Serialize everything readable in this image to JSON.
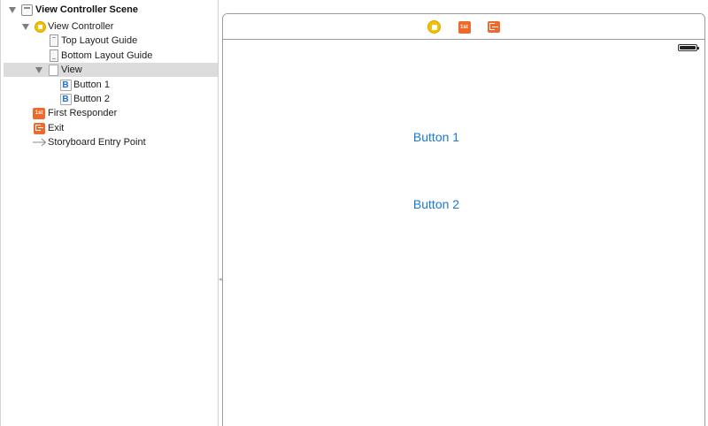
{
  "outline": {
    "items": [
      {
        "label": "View Controller Scene",
        "icon": "scene-icon",
        "disclosure": "expanded"
      },
      {
        "label": "View Controller",
        "icon": "view-controller-icon",
        "disclosure": "expanded"
      },
      {
        "label": "Top Layout Guide",
        "icon": "layout-guide-icon"
      },
      {
        "label": "Bottom Layout Guide",
        "icon": "layout-guide-icon"
      },
      {
        "label": "View",
        "icon": "view-icon",
        "disclosure": "expanded",
        "selected": true
      },
      {
        "label": "Button 1",
        "icon": "button-icon",
        "icon_glyph": "B"
      },
      {
        "label": "Button 2",
        "icon": "button-icon",
        "icon_glyph": "B"
      },
      {
        "label": "First Responder",
        "icon": "first-responder-icon"
      },
      {
        "label": "Exit",
        "icon": "exit-icon"
      },
      {
        "label": "Storyboard Entry Point",
        "icon": "arrow-right-icon"
      }
    ]
  },
  "canvas": {
    "dock_icons": [
      "view-controller-icon",
      "first-responder-icon",
      "exit-icon"
    ],
    "buttons": [
      {
        "label": "Button 1"
      },
      {
        "label": "Button 2"
      }
    ]
  },
  "colors": {
    "accent_blue": "#1a78d2",
    "view_controller_yellow": "#f5c000",
    "first_responder_orange": "#ee6a2c",
    "selection_gray": "#dcdcdc"
  }
}
